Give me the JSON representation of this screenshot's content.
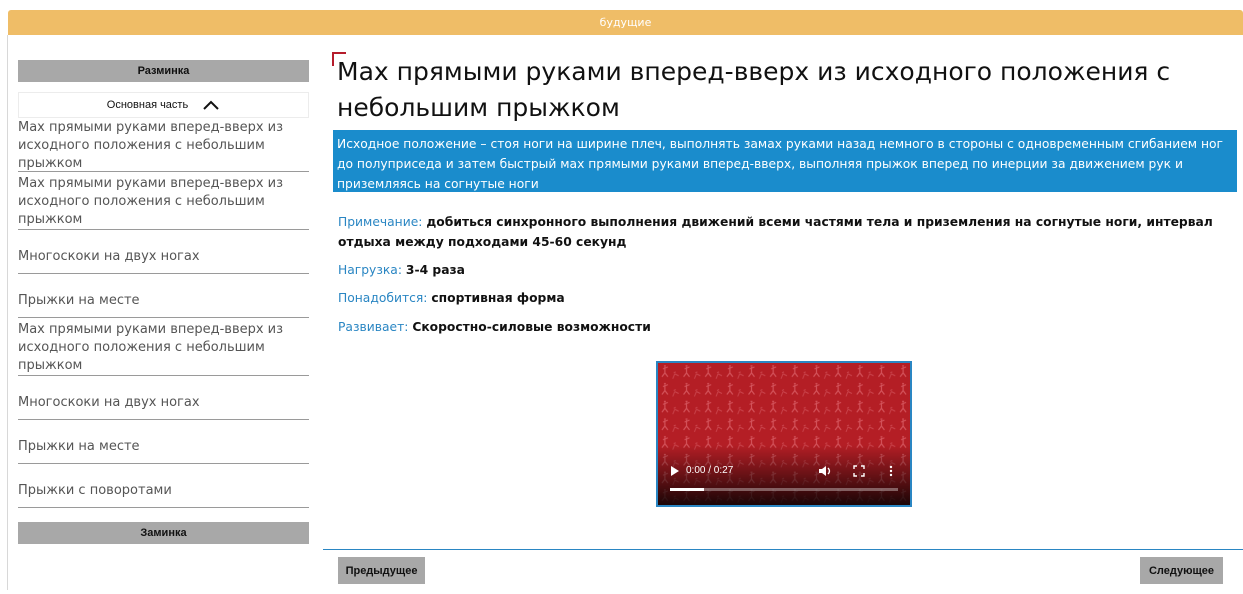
{
  "header": {
    "title": "будущие"
  },
  "sidebar": {
    "warmup_label": "Разминка",
    "main_part_label": "Основная часть",
    "cooldown_label": "Заминка",
    "items": [
      {
        "label": "Мах прямыми руками вперед-вверх из исходного положения с небольшим прыжком"
      },
      {
        "label": "Мах прямыми руками вперед-вверх из исходного положения с небольшим прыжком"
      },
      {
        "label": "Многоскоки на двух ногах"
      },
      {
        "label": "Прыжки на месте"
      },
      {
        "label": "Мах прямыми руками вперед-вверх из исходного положения с небольшим прыжком"
      },
      {
        "label": "Многоскоки на двух ногах"
      },
      {
        "label": "Прыжки на месте"
      },
      {
        "label": "Прыжки с поворотами"
      }
    ]
  },
  "exercise": {
    "title": "Мах прямыми руками вперед-вверх из исходного положения с небольшим прыжком",
    "description": "Исходное положение – стоя ноги на ширине плеч, выполнять замах руками назад немного в стороны с одновременным сгибанием ног до полуприседа и затем быстрый мах прямыми руками вперед-вверх, выполняя прыжок вперед по инерции за движением рук и приземляясь на согнутые ноги",
    "note_label": "Примечание:",
    "note_value": "добиться синхронного выполнения движений всеми частями тела и приземления на согнутые ноги, интервал отдыха между подходами 45-60 секунд",
    "load_label": "Нагрузка:",
    "load_value": "3-4 раза",
    "needs_label": "Понадобится:",
    "needs_value": "спортивная форма",
    "develops_label": "Развивает:",
    "develops_value": "Скоростно-силовые возможности"
  },
  "video": {
    "time": "0:00 / 0:27",
    "progress": 0.15,
    "icons": [
      "play-icon",
      "volume-icon",
      "fullscreen-icon",
      "more-vert-icon"
    ]
  },
  "nav": {
    "prev_label": "Предыдущее",
    "next_label": "Следующее"
  },
  "colors": {
    "header_bg": "#efbd67",
    "accent_blue": "#1a8ccc",
    "button_gray": "#a8a8a8",
    "video_red": "#b41e25"
  }
}
